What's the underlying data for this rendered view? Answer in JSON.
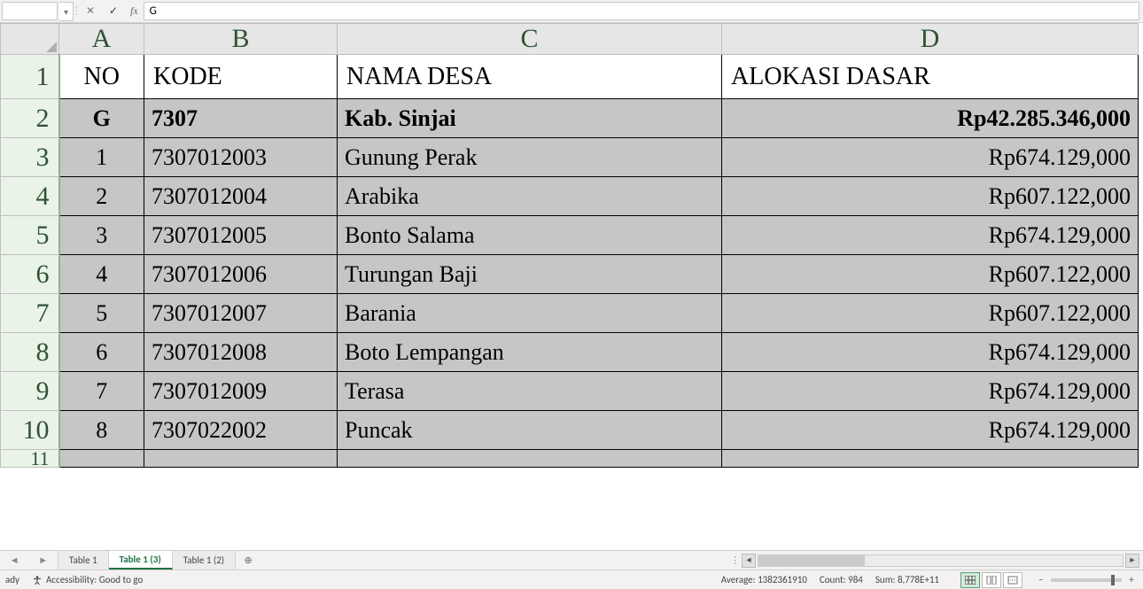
{
  "formula_bar": {
    "name_box": "",
    "formula_value": "G"
  },
  "columns": {
    "A": "A",
    "B": "B",
    "C": "C",
    "D": "D"
  },
  "row_numbers": [
    "1",
    "2",
    "3",
    "4",
    "5",
    "6",
    "7",
    "8",
    "9",
    "10",
    "11"
  ],
  "header_row": {
    "no": "NO",
    "kode": "KODE",
    "nama": "NAMA DESA",
    "alokasi": "ALOKASI DASAR"
  },
  "summary_row": {
    "no": "G",
    "kode": "7307",
    "nama": "Kab.  Sinjai",
    "alokasi": "Rp42.285.346,000"
  },
  "data_rows": [
    {
      "no": "1",
      "kode": "7307012003",
      "nama": "Gunung  Perak",
      "alokasi": "Rp674.129,000"
    },
    {
      "no": "2",
      "kode": "7307012004",
      "nama": "Arabika",
      "alokasi": "Rp607.122,000"
    },
    {
      "no": "3",
      "kode": "7307012005",
      "nama": "Bonto  Salama",
      "alokasi": "Rp674.129,000"
    },
    {
      "no": "4",
      "kode": "7307012006",
      "nama": "Turungan Baji",
      "alokasi": "Rp607.122,000"
    },
    {
      "no": "5",
      "kode": "7307012007",
      "nama": "Barania",
      "alokasi": "Rp607.122,000"
    },
    {
      "no": "6",
      "kode": "7307012008",
      "nama": "Boto  Lempangan",
      "alokasi": "Rp674.129,000"
    },
    {
      "no": "7",
      "kode": "7307012009",
      "nama": "Terasa",
      "alokasi": "Rp674.129,000"
    },
    {
      "no": "8",
      "kode": "7307022002",
      "nama": "Puncak",
      "alokasi": "Rp674.129,000"
    }
  ],
  "sheet_tabs": {
    "t0": "Table 1",
    "t1": "Table 1 (3)",
    "t2": "Table 1 (2)"
  },
  "status": {
    "ready": "ady",
    "accessibility": "Accessibility: Good to go",
    "average_label": "Average:",
    "average_value": "1382361910",
    "count_label": "Count:",
    "count_value": "984",
    "sum_label": "Sum:",
    "sum_value": "8,778E+11",
    "zoom_value": ""
  }
}
